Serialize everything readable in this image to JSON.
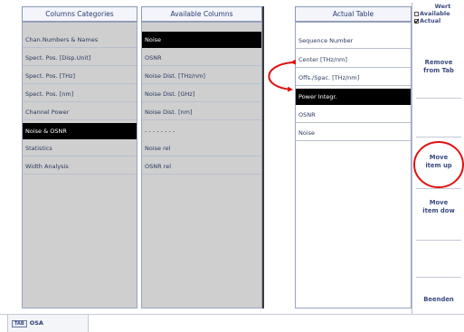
{
  "columns_categories": {
    "header": "Columns Categories",
    "items": [
      {
        "label": "Chan.Numbers & Names",
        "selected": false
      },
      {
        "label": "Spect. Pos. [Disp.Unit]",
        "selected": false
      },
      {
        "label": "Spect. Pos. [THz]",
        "selected": false
      },
      {
        "label": "Spect. Pos. [nm]",
        "selected": false
      },
      {
        "label": "Channel Power",
        "selected": false
      },
      {
        "label": "Noise & OSNR",
        "selected": true
      },
      {
        "label": "Statistics",
        "selected": false
      },
      {
        "label": "Width Analysis",
        "selected": false
      }
    ]
  },
  "available_columns": {
    "header": "Available Columns",
    "items": [
      {
        "label": "Noise",
        "selected": true
      },
      {
        "label": "OSNR",
        "selected": false
      },
      {
        "label": "Noise Dist. [THz/nm]",
        "selected": false
      },
      {
        "label": "Noise Dist. [GHz]",
        "selected": false
      },
      {
        "label": "Noise Dist. [nm]",
        "selected": false
      },
      {
        "label": "- - - - - - - -",
        "selected": false
      },
      {
        "label": "Noise rel",
        "selected": false
      },
      {
        "label": "OSNR rel",
        "selected": false
      }
    ]
  },
  "actual_table": {
    "header": "Actual Table",
    "items": [
      {
        "label": "Sequence Number",
        "selected": false
      },
      {
        "label": "Center [THz/nm]",
        "selected": false
      },
      {
        "label": "Offs./Spac. [THz/nm]",
        "selected": false
      },
      {
        "label": "Power Integr.",
        "selected": true
      },
      {
        "label": "OSNR",
        "selected": false
      },
      {
        "label": "Noise",
        "selected": false
      }
    ]
  },
  "wert": {
    "title": "Wert",
    "options": [
      {
        "label": "Available",
        "checked": false
      },
      {
        "label": "Actual",
        "checked": true
      }
    ]
  },
  "right_buttons": {
    "remove_line1": "Remove",
    "remove_line2": "from Tab",
    "move_up_line1": "Move",
    "move_up_line2": "item up",
    "move_down_line1": "Move",
    "move_down_line2": "item dow",
    "close": "Beenden"
  },
  "bottom_tab": {
    "icon_text": "TAB",
    "label": "OSA"
  },
  "colors": {
    "selection": "#000000",
    "annotation": "#e01010",
    "gray_list_bg": "#cfcfcf"
  }
}
